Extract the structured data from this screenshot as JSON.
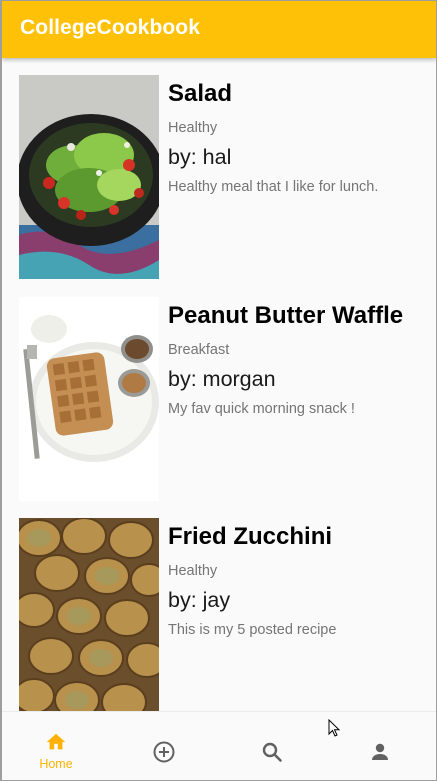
{
  "app": {
    "title": "CollegeCookbook"
  },
  "recipes": [
    {
      "title": "Salad",
      "category": "Healthy",
      "author": "by: hal",
      "description": "Healthy meal that I like for lunch."
    },
    {
      "title": "Peanut Butter Waffle",
      "category": "Breakfast",
      "author": "by: morgan",
      "description": "My fav quick morning snack !"
    },
    {
      "title": "Fried Zucchini",
      "category": "Healthy",
      "author": "by: jay",
      "description": "This is my 5 posted recipe"
    }
  ],
  "bottom_nav": {
    "items": [
      {
        "label": "Home",
        "icon": "home-icon",
        "active": true
      },
      {
        "label": "",
        "icon": "add-circle-icon",
        "active": false
      },
      {
        "label": "",
        "icon": "search-icon",
        "active": false
      },
      {
        "label": "",
        "icon": "person-icon",
        "active": false
      }
    ]
  },
  "colors": {
    "primary": "#ffc107",
    "active_nav": "#ffb300",
    "inactive_nav": "#616161"
  }
}
